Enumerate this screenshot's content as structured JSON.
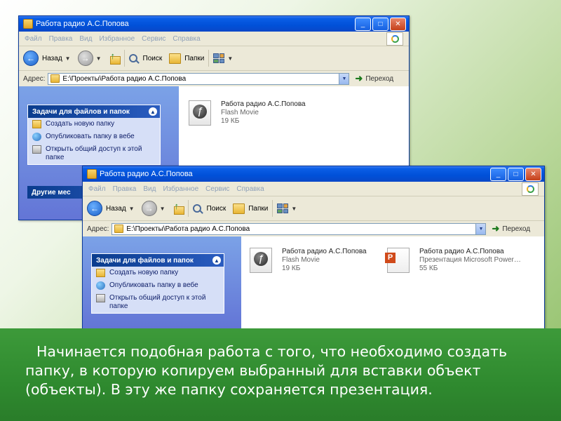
{
  "window": {
    "title": "Работа радио А.С.Попова",
    "menu": [
      "Файл",
      "Правка",
      "Вид",
      "Избранное",
      "Сервис",
      "Справка"
    ],
    "toolbar": {
      "back": "Назад",
      "search": "Поиск",
      "folders": "Папки"
    },
    "address": {
      "label": "Адрес:",
      "path": "E:\\Проекты\\Работа радио А.С.Попова",
      "go": "Переход"
    },
    "tasks": {
      "header": "Задачи для файлов и папок",
      "items": [
        "Создать новую папку",
        "Опубликовать папку в вебе",
        "Открыть общий доступ к этой папке"
      ]
    },
    "other_places": "Другие мес"
  },
  "files": [
    {
      "name": "Работа радио А.С.Попова",
      "type": "Flash Movie",
      "size": "19 КБ",
      "icon": "flash-movie-icon"
    },
    {
      "name": "Работа радио А.С.Попова",
      "type": "Презентация Microsoft Power…",
      "size": "55 КБ",
      "icon": "powerpoint-icon"
    }
  ],
  "slide_text": "Начинается подобная работа с того, что необходимо создать папку, в которую копируем выбранный для вставки объект (объекты). В эту же папку сохраняется презентация."
}
